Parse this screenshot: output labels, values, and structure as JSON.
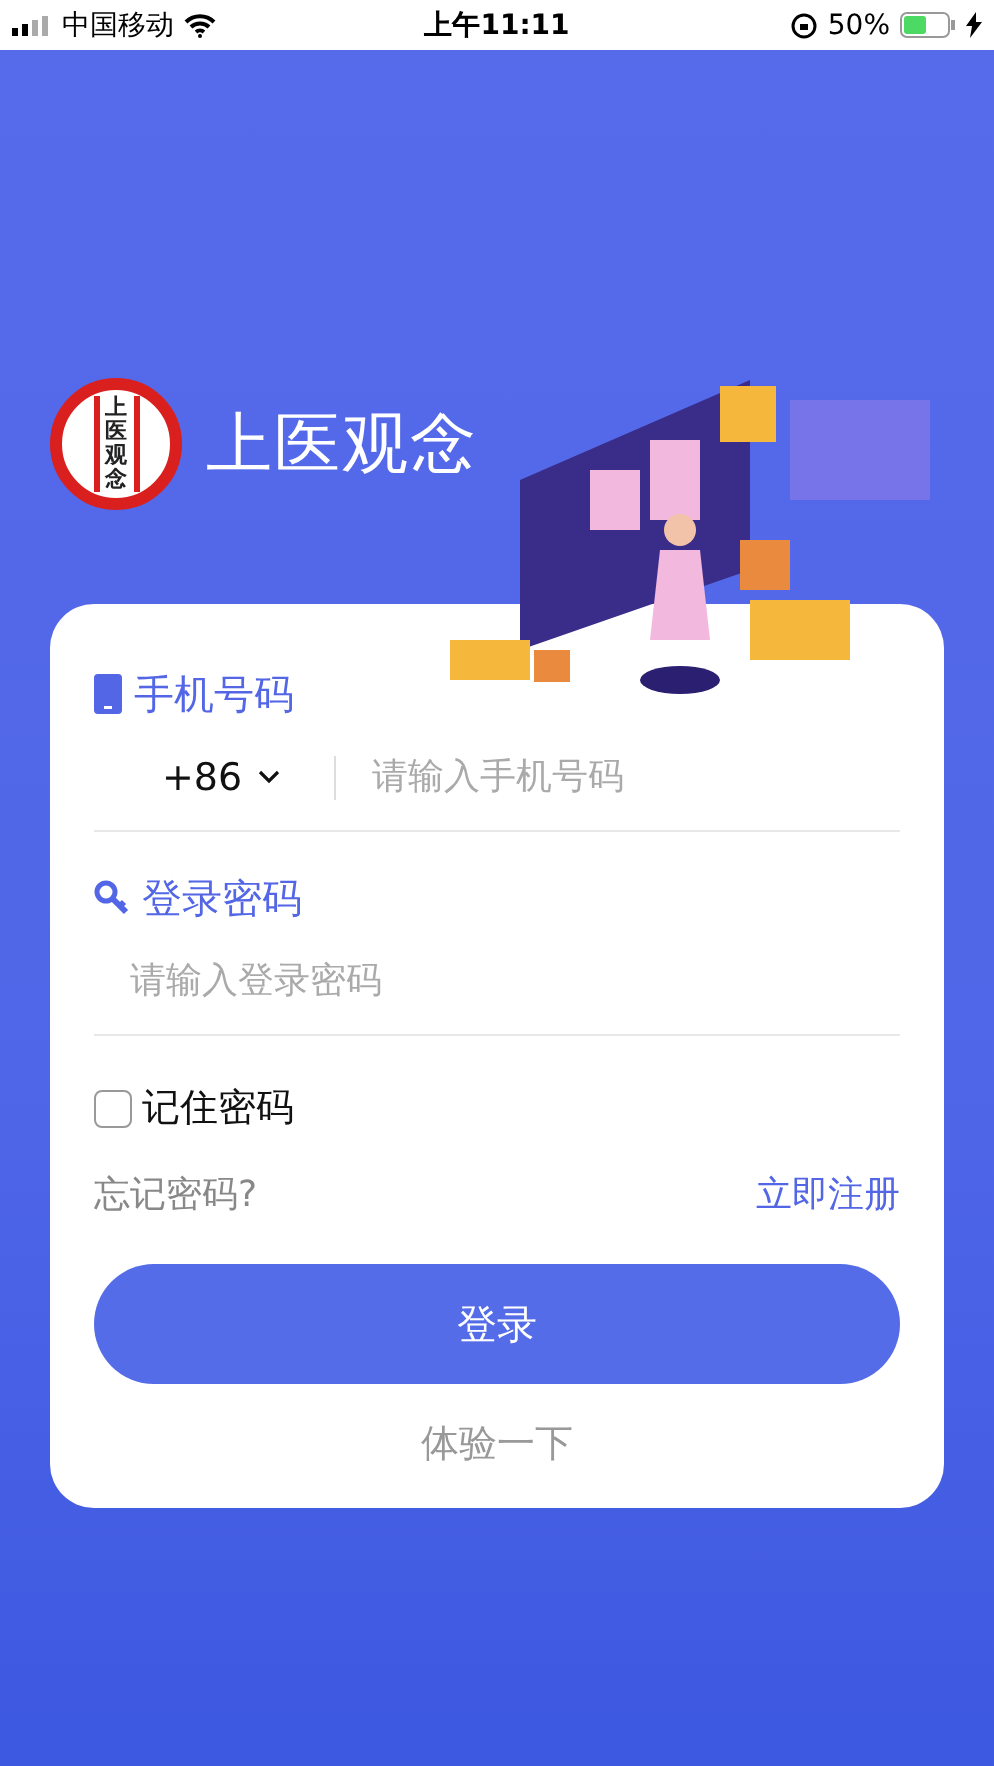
{
  "status_bar": {
    "carrier": "中国移动",
    "time": "上午11:11",
    "battery": "50%"
  },
  "brand": {
    "logo_text": "上医观念",
    "name": "上医观念"
  },
  "form": {
    "phone_label": "手机号码",
    "country_code": "+86",
    "phone_placeholder": "请输入手机号码",
    "password_label": "登录密码",
    "password_placeholder": "请输入登录密码",
    "remember": {
      "label": "记住密码",
      "checked": false
    },
    "forgot": "忘记密码?",
    "register": "立即注册",
    "login_button": "登录",
    "trial": "体验一下"
  }
}
